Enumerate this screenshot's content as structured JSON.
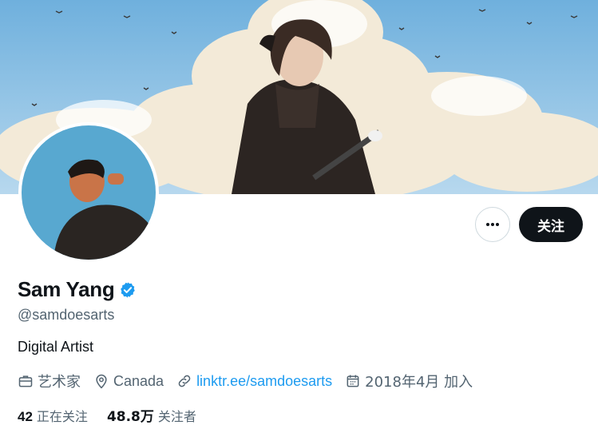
{
  "profile": {
    "name": "Sam Yang",
    "handle": "@samdoesarts",
    "bio": "Digital Artist",
    "category": "艺术家",
    "location": "Canada",
    "link": "linktr.ee/samdoesarts",
    "joined": "2018年4月 加入",
    "following_count": "42",
    "following_label": "正在关注",
    "followers_count": "48.8万",
    "followers_label": "关注者"
  },
  "actions": {
    "more_icon": "more-horizontal-icon",
    "follow_label": "关注"
  },
  "colors": {
    "accent": "#1d9bf0",
    "text_primary": "#0f1419",
    "text_secondary": "#536471",
    "follow_button_bg": "#0f1419",
    "sky": "#8fc3e6"
  }
}
